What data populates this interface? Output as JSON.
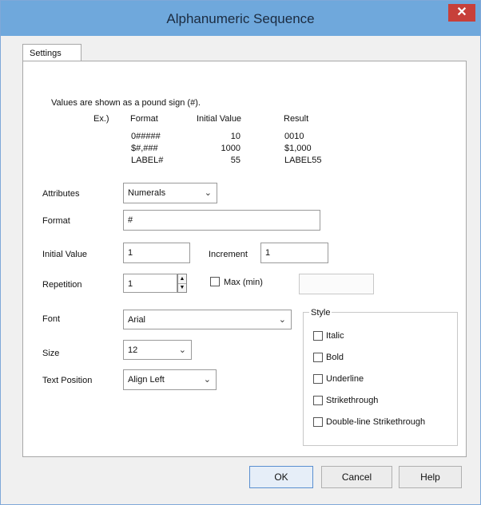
{
  "window": {
    "title": "Alphanumeric Sequence",
    "close_symbol": "✕"
  },
  "tabs": [
    {
      "label": "Settings"
    }
  ],
  "info": {
    "note": "Values are shown as a pound sign (#).",
    "ex_label": "Ex.)",
    "headers": {
      "format": "Format",
      "initial_value": "Initial Value",
      "result": "Result"
    },
    "rows": [
      {
        "format": "0#####",
        "initial_value": "10",
        "result": "0010"
      },
      {
        "format": "$#,###",
        "initial_value": "1000",
        "result": "$1,000"
      },
      {
        "format": "LABEL#",
        "initial_value": "55",
        "result": "LABEL55"
      }
    ]
  },
  "fields": {
    "attributes": {
      "label": "Attributes",
      "value": "Numerals"
    },
    "format": {
      "label": "Format",
      "value": "#"
    },
    "initial_value": {
      "label": "Initial Value",
      "value": "1"
    },
    "increment": {
      "label": "Increment",
      "value": "1"
    },
    "repetition": {
      "label": "Repetition",
      "value": "1"
    },
    "max_min": {
      "label": "Max (min)",
      "value": ""
    },
    "font": {
      "label": "Font",
      "value": "Arial"
    },
    "size": {
      "label": "Size",
      "value": "12"
    },
    "text_position": {
      "label": "Text Position",
      "value": "Align Left"
    }
  },
  "style": {
    "legend": "Style",
    "options": [
      {
        "label": "Italic",
        "checked": false
      },
      {
        "label": "Bold",
        "checked": false
      },
      {
        "label": "Underline",
        "checked": false
      },
      {
        "label": "Strikethrough",
        "checked": false
      },
      {
        "label": "Double-line Strikethrough",
        "checked": false
      }
    ]
  },
  "buttons": {
    "ok": "OK",
    "cancel": "Cancel",
    "help": "Help"
  },
  "colors": {
    "titlebar": "#6fa8dc",
    "close": "#c7403a"
  }
}
